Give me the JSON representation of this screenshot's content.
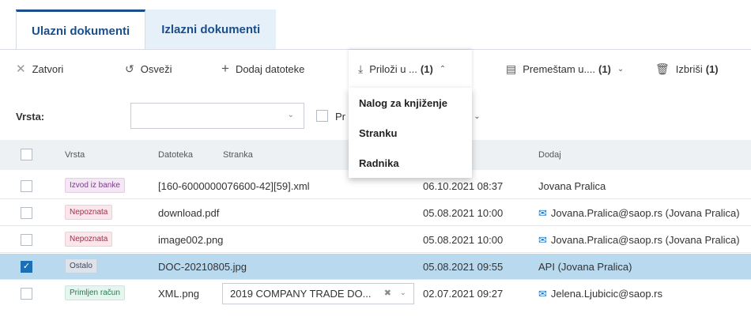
{
  "tabs": [
    {
      "label": "Ulazni dokumenti"
    },
    {
      "label": "Izlazni dokumenti"
    }
  ],
  "toolbar": {
    "close_label": "Zatvori",
    "refresh_label": "Osveži",
    "add_files_label": "Dodaj datoteke",
    "attach_label": "Priloži u ...",
    "attach_count": "(1)",
    "move_label": "Premeštam u....",
    "move_count": "(1)",
    "delete_label": "Izbriši",
    "delete_count": "(1)"
  },
  "attach_menu": {
    "items": [
      {
        "label": "Nalog za knjiženje"
      },
      {
        "label": "Stranku"
      },
      {
        "label": "Radnika"
      }
    ]
  },
  "filter": {
    "type_label": "Vrsta:",
    "type_value": "",
    "checkbox_label": "Pr"
  },
  "table": {
    "columns": [
      "Vrsta",
      "Datoteka",
      "Stranka",
      "Dodaj"
    ],
    "rows": [
      {
        "type": "Izvod iz banke",
        "file": "[160-6000000076600-42][59].xml",
        "party": "",
        "date": "06.10.2021 08:37",
        "added_by": "Jovana Pralica",
        "mail": false,
        "selected": false
      },
      {
        "type": "Nepoznata",
        "file": "download.pdf",
        "party": "",
        "date": "05.08.2021 10:00",
        "added_by": "Jovana.Pralica@saop.rs (Jovana Pralica)",
        "mail": true,
        "selected": false
      },
      {
        "type": "Nepoznata",
        "file": "image002.png",
        "party": "",
        "date": "05.08.2021 10:00",
        "added_by": "Jovana.Pralica@saop.rs (Jovana Pralica)",
        "mail": true,
        "selected": false
      },
      {
        "type": "Ostalo",
        "file": "DOC-20210805.jpg",
        "party": "",
        "date": "05.08.2021 09:55",
        "added_by": "API (Jovana Pralica)",
        "mail": false,
        "selected": true
      },
      {
        "type": "Primljen račun",
        "file": "XML.png",
        "party": "2019 COMPANY TRADE DO...",
        "date": "02.07.2021 09:27",
        "added_by": "Jelena.Ljubicic@saop.rs",
        "mail": true,
        "selected": false
      }
    ]
  },
  "colors": {
    "primary": "#1b4f8c",
    "selected_row": "#b9d9ee",
    "header_bg": "#eef1f4"
  }
}
